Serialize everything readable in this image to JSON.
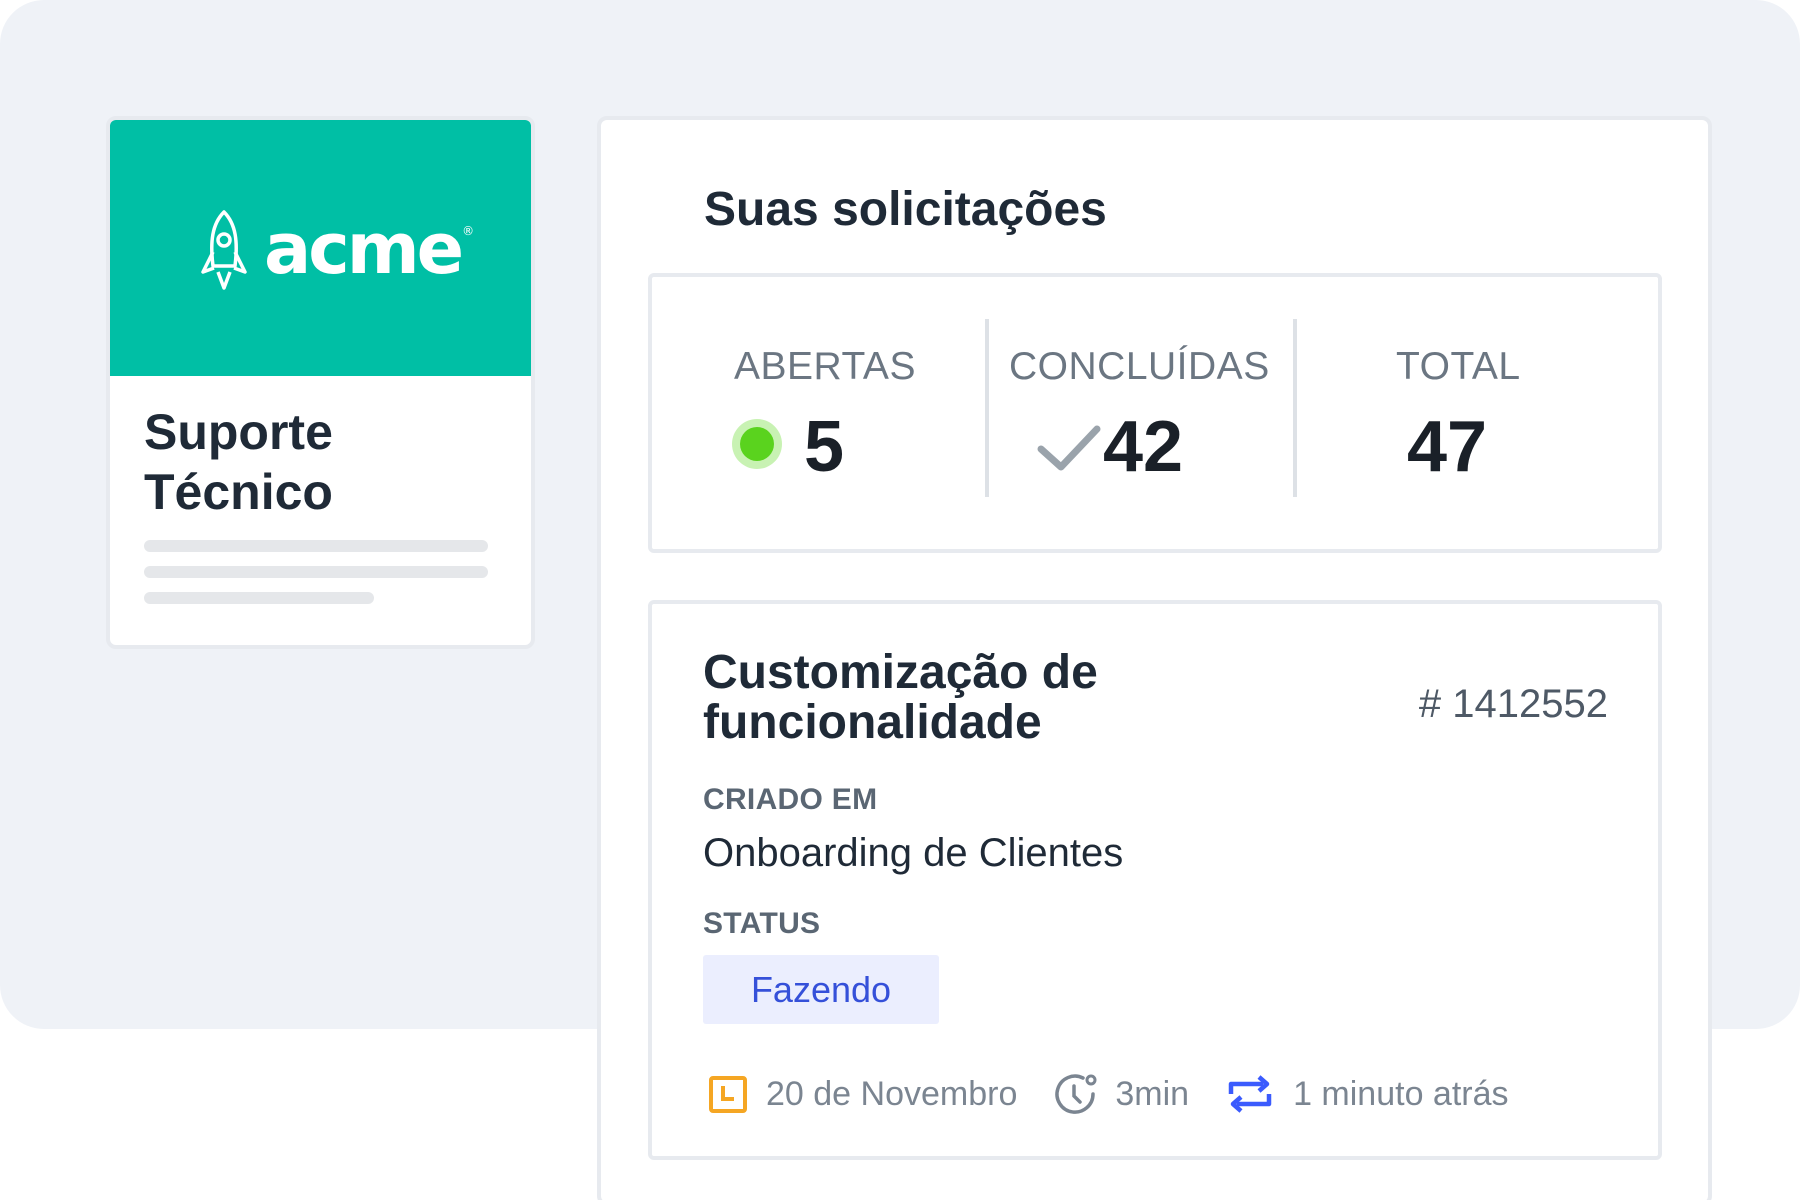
{
  "brand": {
    "name": "acme",
    "registered_mark": "®",
    "color": "#00bfa5"
  },
  "portal": {
    "title": "Suporte Técnico"
  },
  "requests": {
    "title": "Suas solicitações",
    "stats": {
      "open": {
        "label": "ABERTAS",
        "value": "5",
        "indicator_color": "#5ad31e"
      },
      "done": {
        "label": "CONCLUÍDAS",
        "value": "42",
        "icon": "check-icon"
      },
      "total": {
        "label": "TOTAL",
        "value": "47"
      }
    }
  },
  "ticket": {
    "title": "Customização de funcionalidade",
    "id": "# 1412552",
    "created_label": "CRIADO EM",
    "created_value": "Onboarding de Clientes",
    "status_label": "STATUS",
    "status_value": "Fazendo",
    "status_color": "#3550d9",
    "meta": {
      "date": {
        "icon": "calendar-icon",
        "text": "20 de Novembro"
      },
      "duration": {
        "icon": "timer-icon",
        "text": "3min"
      },
      "updated": {
        "icon": "refresh-icon",
        "text": "1 minuto atrás"
      }
    }
  }
}
